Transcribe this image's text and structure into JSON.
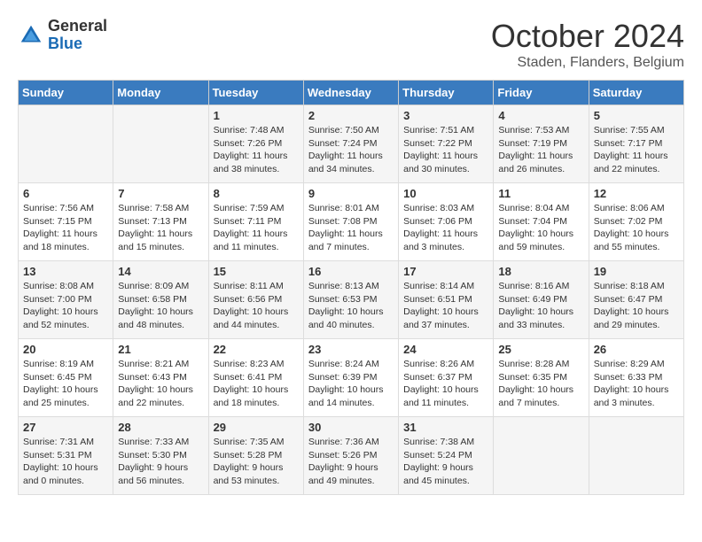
{
  "logo": {
    "general": "General",
    "blue": "Blue"
  },
  "title": "October 2024",
  "location": "Staden, Flanders, Belgium",
  "weekdays": [
    "Sunday",
    "Monday",
    "Tuesday",
    "Wednesday",
    "Thursday",
    "Friday",
    "Saturday"
  ],
  "weeks": [
    [
      {
        "day": "",
        "detail": ""
      },
      {
        "day": "",
        "detail": ""
      },
      {
        "day": "1",
        "detail": "Sunrise: 7:48 AM\nSunset: 7:26 PM\nDaylight: 11 hours and 38 minutes."
      },
      {
        "day": "2",
        "detail": "Sunrise: 7:50 AM\nSunset: 7:24 PM\nDaylight: 11 hours and 34 minutes."
      },
      {
        "day": "3",
        "detail": "Sunrise: 7:51 AM\nSunset: 7:22 PM\nDaylight: 11 hours and 30 minutes."
      },
      {
        "day": "4",
        "detail": "Sunrise: 7:53 AM\nSunset: 7:19 PM\nDaylight: 11 hours and 26 minutes."
      },
      {
        "day": "5",
        "detail": "Sunrise: 7:55 AM\nSunset: 7:17 PM\nDaylight: 11 hours and 22 minutes."
      }
    ],
    [
      {
        "day": "6",
        "detail": "Sunrise: 7:56 AM\nSunset: 7:15 PM\nDaylight: 11 hours and 18 minutes."
      },
      {
        "day": "7",
        "detail": "Sunrise: 7:58 AM\nSunset: 7:13 PM\nDaylight: 11 hours and 15 minutes."
      },
      {
        "day": "8",
        "detail": "Sunrise: 7:59 AM\nSunset: 7:11 PM\nDaylight: 11 hours and 11 minutes."
      },
      {
        "day": "9",
        "detail": "Sunrise: 8:01 AM\nSunset: 7:08 PM\nDaylight: 11 hours and 7 minutes."
      },
      {
        "day": "10",
        "detail": "Sunrise: 8:03 AM\nSunset: 7:06 PM\nDaylight: 11 hours and 3 minutes."
      },
      {
        "day": "11",
        "detail": "Sunrise: 8:04 AM\nSunset: 7:04 PM\nDaylight: 10 hours and 59 minutes."
      },
      {
        "day": "12",
        "detail": "Sunrise: 8:06 AM\nSunset: 7:02 PM\nDaylight: 10 hours and 55 minutes."
      }
    ],
    [
      {
        "day": "13",
        "detail": "Sunrise: 8:08 AM\nSunset: 7:00 PM\nDaylight: 10 hours and 52 minutes."
      },
      {
        "day": "14",
        "detail": "Sunrise: 8:09 AM\nSunset: 6:58 PM\nDaylight: 10 hours and 48 minutes."
      },
      {
        "day": "15",
        "detail": "Sunrise: 8:11 AM\nSunset: 6:56 PM\nDaylight: 10 hours and 44 minutes."
      },
      {
        "day": "16",
        "detail": "Sunrise: 8:13 AM\nSunset: 6:53 PM\nDaylight: 10 hours and 40 minutes."
      },
      {
        "day": "17",
        "detail": "Sunrise: 8:14 AM\nSunset: 6:51 PM\nDaylight: 10 hours and 37 minutes."
      },
      {
        "day": "18",
        "detail": "Sunrise: 8:16 AM\nSunset: 6:49 PM\nDaylight: 10 hours and 33 minutes."
      },
      {
        "day": "19",
        "detail": "Sunrise: 8:18 AM\nSunset: 6:47 PM\nDaylight: 10 hours and 29 minutes."
      }
    ],
    [
      {
        "day": "20",
        "detail": "Sunrise: 8:19 AM\nSunset: 6:45 PM\nDaylight: 10 hours and 25 minutes."
      },
      {
        "day": "21",
        "detail": "Sunrise: 8:21 AM\nSunset: 6:43 PM\nDaylight: 10 hours and 22 minutes."
      },
      {
        "day": "22",
        "detail": "Sunrise: 8:23 AM\nSunset: 6:41 PM\nDaylight: 10 hours and 18 minutes."
      },
      {
        "day": "23",
        "detail": "Sunrise: 8:24 AM\nSunset: 6:39 PM\nDaylight: 10 hours and 14 minutes."
      },
      {
        "day": "24",
        "detail": "Sunrise: 8:26 AM\nSunset: 6:37 PM\nDaylight: 10 hours and 11 minutes."
      },
      {
        "day": "25",
        "detail": "Sunrise: 8:28 AM\nSunset: 6:35 PM\nDaylight: 10 hours and 7 minutes."
      },
      {
        "day": "26",
        "detail": "Sunrise: 8:29 AM\nSunset: 6:33 PM\nDaylight: 10 hours and 3 minutes."
      }
    ],
    [
      {
        "day": "27",
        "detail": "Sunrise: 7:31 AM\nSunset: 5:31 PM\nDaylight: 10 hours and 0 minutes."
      },
      {
        "day": "28",
        "detail": "Sunrise: 7:33 AM\nSunset: 5:30 PM\nDaylight: 9 hours and 56 minutes."
      },
      {
        "day": "29",
        "detail": "Sunrise: 7:35 AM\nSunset: 5:28 PM\nDaylight: 9 hours and 53 minutes."
      },
      {
        "day": "30",
        "detail": "Sunrise: 7:36 AM\nSunset: 5:26 PM\nDaylight: 9 hours and 49 minutes."
      },
      {
        "day": "31",
        "detail": "Sunrise: 7:38 AM\nSunset: 5:24 PM\nDaylight: 9 hours and 45 minutes."
      },
      {
        "day": "",
        "detail": ""
      },
      {
        "day": "",
        "detail": ""
      }
    ]
  ]
}
